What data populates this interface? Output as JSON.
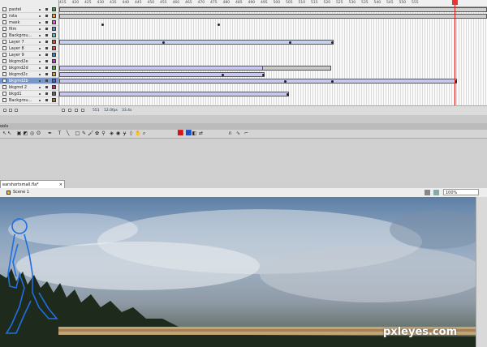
{
  "timeline": {
    "layers": [
      {
        "name": "pastel",
        "swatch": "#2f9e44"
      },
      {
        "name": "rota",
        "swatch": "#e6a817"
      },
      {
        "name": "mask",
        "swatch": "#e060c0"
      },
      {
        "name": "film",
        "swatch": "#5b88d4"
      },
      {
        "name": "Backgrou...",
        "swatch": "#50c0d0"
      },
      {
        "name": "Layer 7",
        "swatch": "#b85a2f"
      },
      {
        "name": "Layer 8",
        "swatch": "#e04a4a"
      },
      {
        "name": "Layer 9",
        "swatch": "#2f7fd0"
      },
      {
        "name": "bkgmd2e",
        "swatch": "#b040b0"
      },
      {
        "name": "bkgmd2d",
        "swatch": "#3fa84a"
      },
      {
        "name": "bkgmd2c",
        "swatch": "#c8b020"
      },
      {
        "name": "bkgmd2b",
        "swatch": "#4060e0"
      },
      {
        "name": "bkgmd 2",
        "swatch": "#c03060"
      },
      {
        "name": "bkgd1",
        "swatch": "#606060"
      },
      {
        "name": "Backgrou...",
        "swatch": "#a07030"
      }
    ],
    "selected_layer": "bkgmd2b",
    "ruler_ticks": [
      "415",
      "420",
      "425",
      "430",
      "435",
      "440",
      "445",
      "450",
      "455",
      "460",
      "465",
      "470",
      "475",
      "480",
      "485",
      "490",
      "495",
      "500",
      "505",
      "510",
      "515",
      "520",
      "525",
      "530",
      "535",
      "540",
      "545",
      "550",
      "555"
    ],
    "status": {
      "current_frame": "551",
      "fps": "12.0fps",
      "time": "33.4s"
    }
  },
  "tools": {
    "header": "ools",
    "items": [
      "selection",
      "subselection",
      "free-transform",
      "gradient-transform",
      "3d-rotation",
      "lasso",
      "pen",
      "text",
      "line",
      "rectangle",
      "pencil",
      "brush",
      "deco",
      "bone",
      "paint-bucket",
      "ink-bottle",
      "eyedropper",
      "eraser",
      "hand",
      "zoom",
      "stroke-color",
      "fill-color",
      "black-white",
      "swap-colors",
      "snap",
      "smooth",
      "straighten"
    ],
    "stroke_color": "#d01818",
    "fill_color": "#1a4fd0"
  },
  "document": {
    "tab_title": "earshortsmall.fla*",
    "scene": "Scene 1",
    "zoom": "100%"
  },
  "watermark": "pxleyes.com"
}
